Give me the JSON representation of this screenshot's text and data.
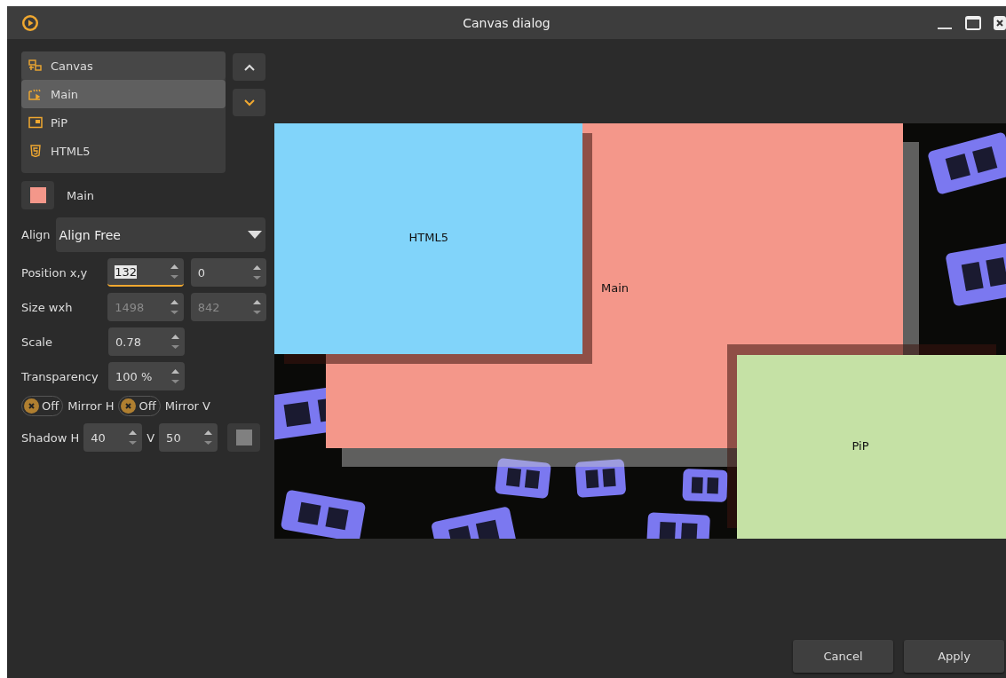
{
  "window": {
    "title": "Canvas dialog"
  },
  "layers": [
    {
      "kind": "canvas",
      "label": "Canvas",
      "selected": false
    },
    {
      "kind": "main",
      "label": "Main",
      "selected": true
    },
    {
      "kind": "pip",
      "label": "PiP",
      "selected": false
    },
    {
      "kind": "html5",
      "label": "HTML5",
      "selected": false
    }
  ],
  "current_layer": {
    "color": "#f4978a",
    "label": "Main"
  },
  "align": {
    "label": "Align",
    "value": "Align Free"
  },
  "fields": [
    {
      "label": "Position x,y",
      "values": [
        {
          "value": "132",
          "focused": true,
          "disabled": false
        },
        {
          "value": "0",
          "focused": false,
          "disabled": false
        }
      ]
    },
    {
      "label": "Size wxh",
      "values": [
        {
          "value": "1498",
          "focused": false,
          "disabled": true
        },
        {
          "value": "842",
          "focused": false,
          "disabled": true
        }
      ]
    },
    {
      "label": "Scale",
      "values": [
        {
          "value": "0.78",
          "focused": false,
          "disabled": false
        }
      ]
    },
    {
      "label": "Transparency",
      "values": [
        {
          "value": "100 %",
          "focused": false,
          "disabled": false
        }
      ]
    }
  ],
  "mirrors": [
    {
      "state": "Off",
      "on": false,
      "label": "Mirror H"
    },
    {
      "state": "Off",
      "on": false,
      "label": "Mirror V"
    }
  ],
  "shadow": {
    "label": "Shadow H",
    "h": "40",
    "v_label": "V",
    "v": "50",
    "color": "#808080"
  },
  "preview": {
    "layers": [
      {
        "kind": "main",
        "label": "Main",
        "color": "#f4978a"
      },
      {
        "kind": "html5",
        "label": "HTML5",
        "color": "#81d4fa"
      },
      {
        "kind": "pip",
        "label": "PiP",
        "color": "#c5e1a5"
      }
    ]
  },
  "buttons": [
    "Cancel",
    "Apply"
  ]
}
